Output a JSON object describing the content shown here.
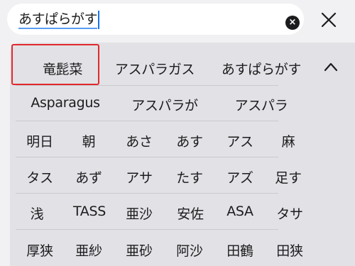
{
  "search": {
    "value": "あすぱらがす"
  },
  "buttons": {
    "clear_icon": "×"
  },
  "candidates": {
    "row1": [
      "竜髭菜",
      "アスパラガス",
      "あすぱらがす"
    ],
    "row2": [
      "Asparagus",
      "アスパラが",
      "アスパラ"
    ],
    "row3": [
      "明日",
      "朝",
      "あさ",
      "あす",
      "アス",
      "麻"
    ],
    "row4": [
      "タス",
      "あず",
      "アサ",
      "たす",
      "アズ",
      "足す"
    ],
    "row5": [
      "浅",
      "TASS",
      "亜沙",
      "安佐",
      "ASA",
      "タサ"
    ],
    "row6": [
      "厚狭",
      "亜紗",
      "亜砂",
      "阿沙",
      "田鶴",
      "田狭"
    ]
  },
  "colors": {
    "highlight": "#e2292c",
    "caret": "#1a73e8"
  }
}
